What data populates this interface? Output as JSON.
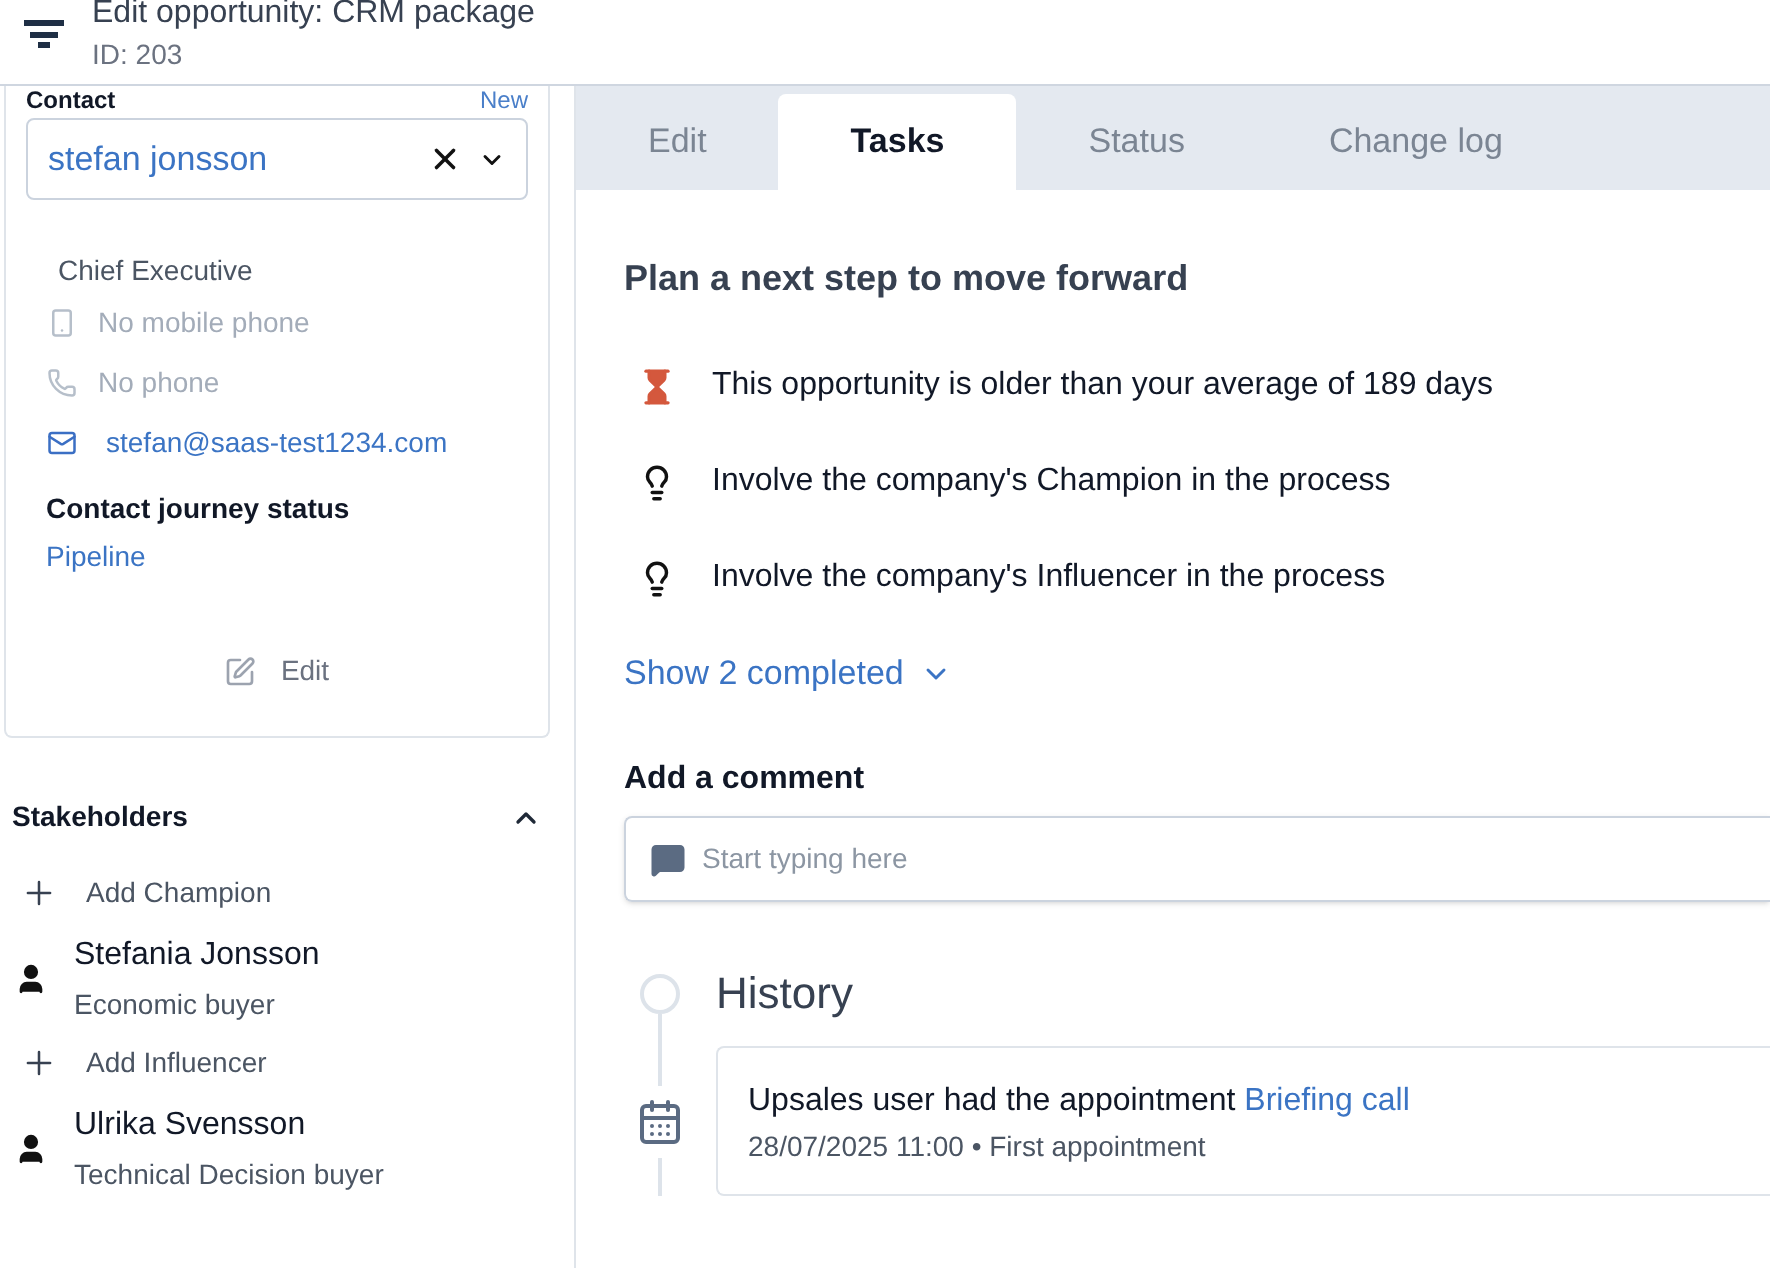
{
  "header": {
    "title": "Edit opportunity: CRM package",
    "subtitle": "ID: 203"
  },
  "contact": {
    "label": "Contact",
    "new_link": "New",
    "selected": "stefan jonsson",
    "title": "Chief Executive",
    "details": [
      {
        "kind": "mobile",
        "text": "No mobile phone",
        "missing": true
      },
      {
        "kind": "phone",
        "text": "No phone",
        "missing": true
      },
      {
        "kind": "email",
        "text": "stefan@saas-test1234.com",
        "missing": false
      }
    ],
    "journey_label": "Contact journey status",
    "journey_value": "Pipeline",
    "edit": "Edit"
  },
  "stakeholders": {
    "title": "Stakeholders",
    "expanded": true,
    "items": [
      {
        "kind": "add",
        "text": "Add Champion"
      },
      {
        "kind": "person",
        "name": "Stefania Jonsson",
        "role": "Economic buyer"
      },
      {
        "kind": "add",
        "text": "Add Influencer"
      },
      {
        "kind": "person",
        "name": "Ulrika Svensson",
        "role": "Technical Decision buyer"
      }
    ]
  },
  "tabs": [
    {
      "label": "Edit",
      "selected": false
    },
    {
      "label": "Tasks",
      "selected": true
    },
    {
      "label": "Status",
      "selected": false
    },
    {
      "label": "Change log",
      "selected": false
    }
  ],
  "plan": {
    "title": "Plan a next step to move forward",
    "items": [
      {
        "kind": "warning",
        "text": "This opportunity is older than your average of 189 days"
      },
      {
        "kind": "tip",
        "text": "Involve the company's Champion in the process"
      },
      {
        "kind": "tip",
        "text": "Involve the company's Influencer in the process"
      }
    ],
    "show_completed": "Show 2 completed"
  },
  "comment": {
    "label": "Add a comment",
    "placeholder": "Start typing here"
  },
  "history": {
    "title": "History",
    "entries": [
      {
        "text": "Upsales user had the appointment",
        "link": "Briefing call",
        "meta": "28/07/2025 11:00 • First appointment"
      }
    ]
  }
}
